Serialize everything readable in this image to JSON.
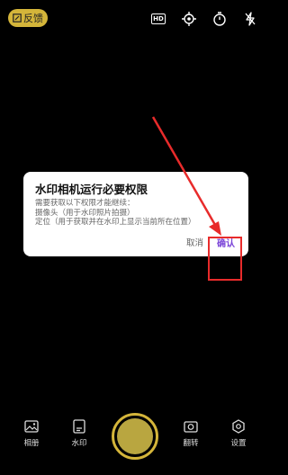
{
  "topbar": {
    "feedback_label": "反馈",
    "hd_label": "HD"
  },
  "dialog": {
    "title": "水印相机运行必要权限",
    "lines": [
      "需要获取以下权限才能继续：",
      "摄像头（用于水印照片拍摄）",
      "定位（用于获取并在水印上显示当前所在位置）"
    ],
    "cancel_label": "取消",
    "confirm_label": "确认"
  },
  "bottom": {
    "album_label": "相册",
    "watermark_label": "水印",
    "flip_label": "翻转",
    "settings_label": "设置"
  },
  "colors": {
    "accent": "#d4b53a",
    "confirm": "#7b45d8",
    "highlight": "#e82b2b"
  }
}
